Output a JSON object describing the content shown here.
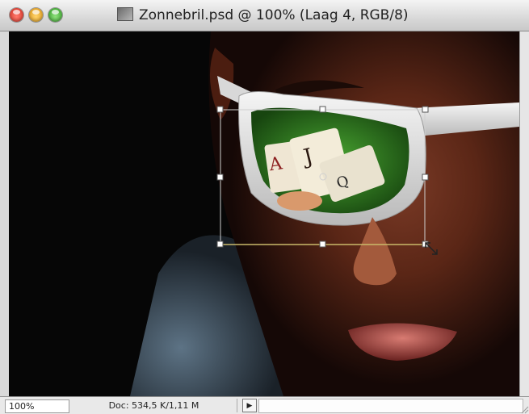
{
  "window": {
    "title": "Zonnebril.psd @ 100% (Laag 4, RGB/8)",
    "file_icon": "photoshop-document-icon"
  },
  "traffic_lights": [
    "close",
    "minimize",
    "zoom"
  ],
  "canvas": {
    "layer_content": "playing cards reflection (Ace, Jack) on green felt inside sunglasses lens",
    "transform_box": true,
    "cursor": "scale-cursor-icon"
  },
  "statusbar": {
    "zoom": "100%",
    "doc_info": "Doc: 534,5 K/1,11 M",
    "menu_arrow": "▶"
  }
}
